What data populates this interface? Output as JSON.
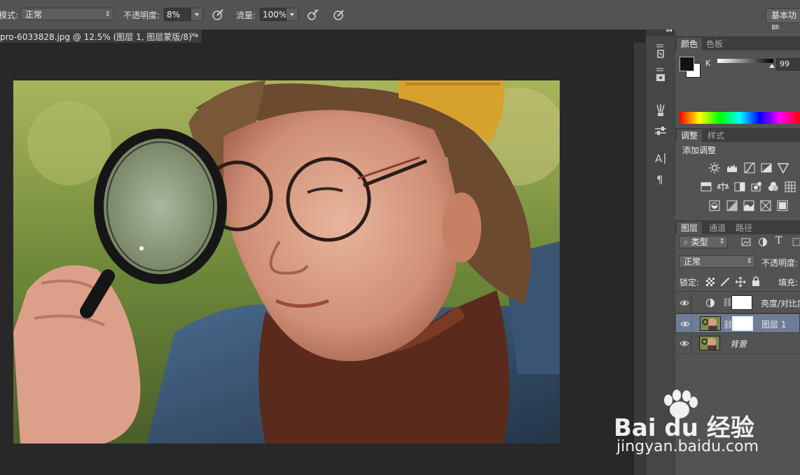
{
  "options_bar": {
    "mode_label": "模式:",
    "mode_value": "正常",
    "opacity_label": "不透明度:",
    "opacity_value": "8%",
    "flow_label": "流量:",
    "flow_value": "100%",
    "workspace_button": "基本功能"
  },
  "document_tab": {
    "title": "pro-6033828.jpg @ 12.5% (图层 1, 图层蒙版/8) *",
    "close": "×"
  },
  "color_panel": {
    "tabs": [
      "颜色",
      "色板"
    ],
    "channel_label": "K",
    "channel_value": "99"
  },
  "adjust_panel": {
    "tabs": [
      "调整",
      "样式"
    ],
    "heading": "添加调整"
  },
  "layers_panel": {
    "tabs": [
      "图层",
      "通道",
      "路径"
    ],
    "filter_kind": "类型",
    "blend_mode": "正常",
    "opacity_label": "不透明度:",
    "lock_label": "锁定:",
    "fill_label": "填充:",
    "layers": [
      {
        "name": "亮度/对比度",
        "type": "adjustment",
        "selected": false
      },
      {
        "name": "图层 1",
        "type": "pixel-with-mask",
        "selected": true
      },
      {
        "name": "背景",
        "type": "background",
        "selected": false
      }
    ]
  },
  "watermark": {
    "brand": "Bai du 经验",
    "url": "jingyan.baidu.com"
  }
}
